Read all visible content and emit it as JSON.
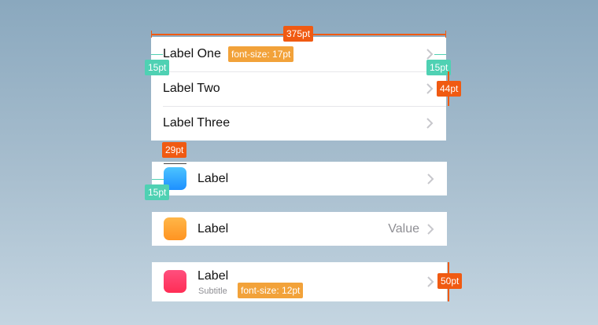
{
  "group1": {
    "rows": [
      {
        "label": "Label One"
      },
      {
        "label": "Label Two"
      },
      {
        "label": "Label Three"
      }
    ]
  },
  "cell_icon": {
    "label": "Label",
    "icon_color": "#2ea8ff"
  },
  "cell_value": {
    "label": "Label",
    "value": "Value",
    "icon_color": "#ffa62e"
  },
  "cell_subtitle": {
    "label": "Label",
    "subtitle": "Subtitle",
    "icon_color": "#ff3b6b"
  },
  "annotations": {
    "width": "375pt",
    "font_main": "font-size: 17pt",
    "inset_left": "15pt",
    "inset_right": "15pt",
    "row_height": "44pt",
    "icon_size": "29pt",
    "icon_inset": "15pt",
    "font_subtitle": "font-size: 12pt",
    "subtitle_row_height": "50pt"
  },
  "colors": {
    "annotation_orange": "#f05a12",
    "annotation_yellow": "#f2a23a",
    "annotation_teal": "#4fd1b3",
    "chevron": "#c7c7cc"
  }
}
